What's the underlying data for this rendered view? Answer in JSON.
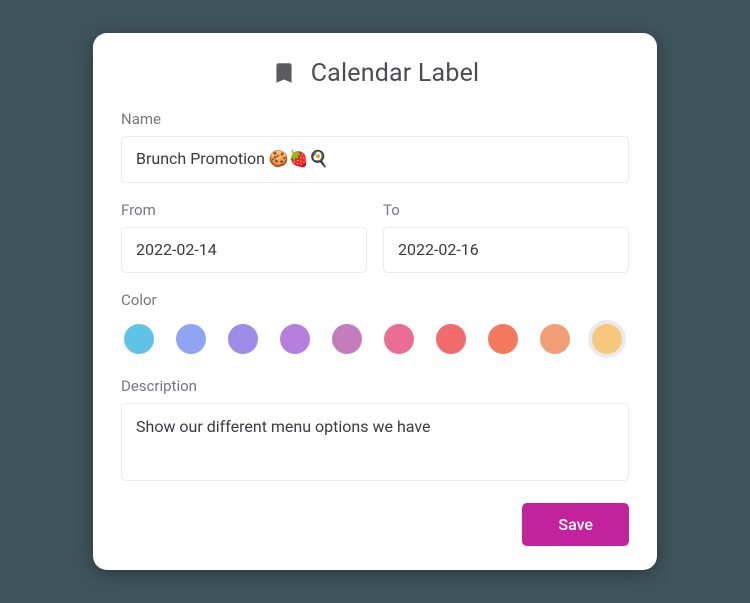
{
  "header": {
    "icon": "bookmark-icon",
    "title": "Calendar Label"
  },
  "labels": {
    "name": "Name",
    "from": "From",
    "to": "To",
    "color": "Color",
    "description": "Description"
  },
  "values": {
    "name": "Brunch Promotion 🍪🍓🍳",
    "from": "2022-02-14",
    "to": "2022-02-16",
    "description": "Show our different menu options we have"
  },
  "colors": [
    {
      "hex": "#5fc3e6",
      "selected": false
    },
    {
      "hex": "#8fa4f2",
      "selected": false
    },
    {
      "hex": "#9d8ce8",
      "selected": false
    },
    {
      "hex": "#b67fdd",
      "selected": false
    },
    {
      "hex": "#c57cbc",
      "selected": false
    },
    {
      "hex": "#e96d95",
      "selected": false
    },
    {
      "hex": "#f36c6c",
      "selected": false
    },
    {
      "hex": "#f47a5f",
      "selected": false
    },
    {
      "hex": "#f19d76",
      "selected": false
    },
    {
      "hex": "#f6c87b",
      "selected": true
    }
  ],
  "buttons": {
    "save": "Save"
  }
}
